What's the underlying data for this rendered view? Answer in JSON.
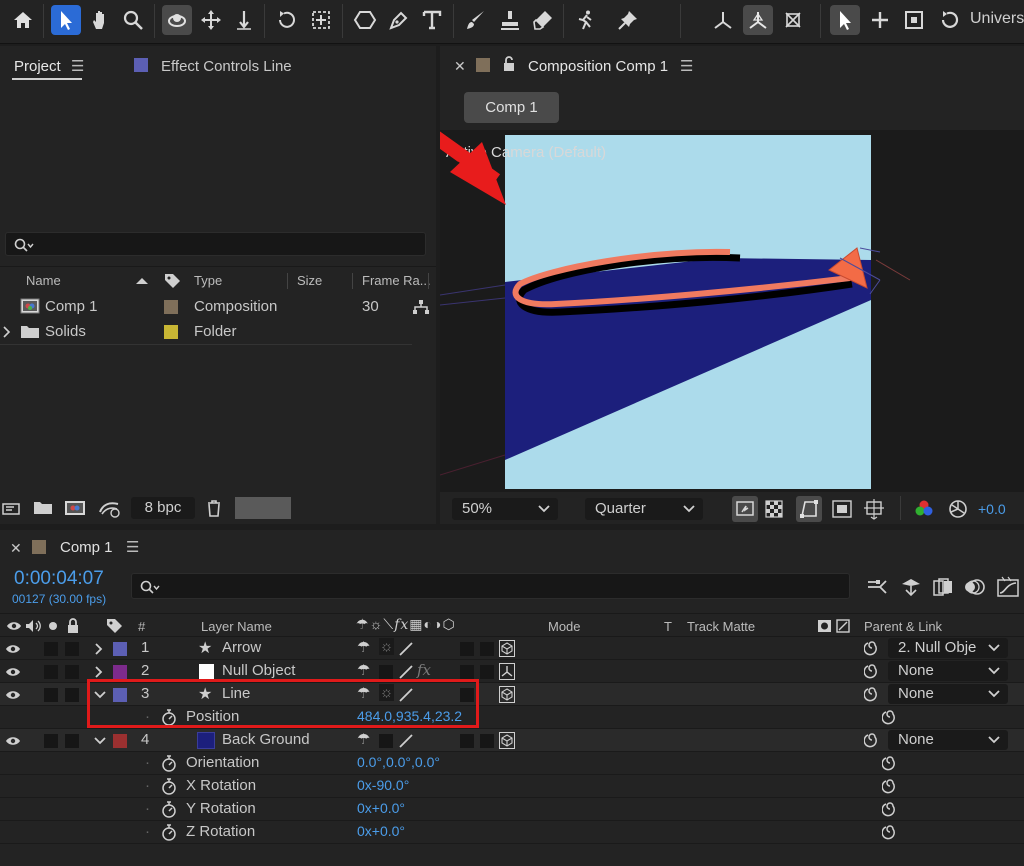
{
  "toolbar": {
    "workspace_label": "Universa"
  },
  "project_panel": {
    "tab_project": "Project",
    "tab_effect_controls": "Effect Controls Line",
    "search_placeholder": "",
    "columns": {
      "name": "Name",
      "type": "Type",
      "size": "Size",
      "frame_rate": "Frame Ra..."
    },
    "items": [
      {
        "name": "Comp 1",
        "type": "Composition",
        "frame_rate": "30",
        "swatch_color": "#7f6f5a"
      },
      {
        "name": "Solids",
        "type": "Folder",
        "frame_rate": "",
        "swatch_color": "#c8b634"
      }
    ],
    "bpc_label": "8 bpc"
  },
  "comp_panel": {
    "tab_title": "Composition Comp 1",
    "comp_button": "Comp 1",
    "camera_label": "Active Camera (Default)",
    "zoom_value": "50%",
    "resolution_value": "Quarter",
    "exposure_value": "+0.0",
    "colors": {
      "background": "#acdbeb",
      "plane": "#1c1f7c",
      "stroke": "#f07a60",
      "arrow": "#f36b46",
      "annotation_arrow": "#e81c1c"
    }
  },
  "timeline": {
    "tab_title": "Comp 1",
    "timecode": "0:00:04:07",
    "frame_info": "00127 (30.00 fps)",
    "headers": {
      "number": "#",
      "layer_name": "Layer Name",
      "mode": "Mode",
      "t": "T",
      "track_matte": "Track Matte",
      "parent_link": "Parent & Link"
    },
    "layers": [
      {
        "number": "1",
        "name": "Arrow",
        "label_color": "#5c5fb4",
        "parent": "2. Null Obje"
      },
      {
        "number": "2",
        "name": "Null Object",
        "label_color": "#7d2b8c",
        "parent": "None"
      },
      {
        "number": "3",
        "name": "Line",
        "label_color": "#5c5fb4",
        "parent": "None"
      },
      {
        "number": "4",
        "name": "Back Ground",
        "label_color": "#9b3030",
        "parent": "None"
      }
    ],
    "line_position": {
      "label": "Position",
      "value": "484.0,935.4,23.2"
    },
    "bg_properties": [
      {
        "label": "Orientation",
        "value": "0.0°,0.0°,0.0°"
      },
      {
        "label": "X Rotation",
        "value": "0x-90.0°"
      },
      {
        "label": "Y Rotation",
        "value": "0x+0.0°"
      },
      {
        "label": "Z Rotation",
        "value": "0x+0.0°"
      }
    ]
  }
}
